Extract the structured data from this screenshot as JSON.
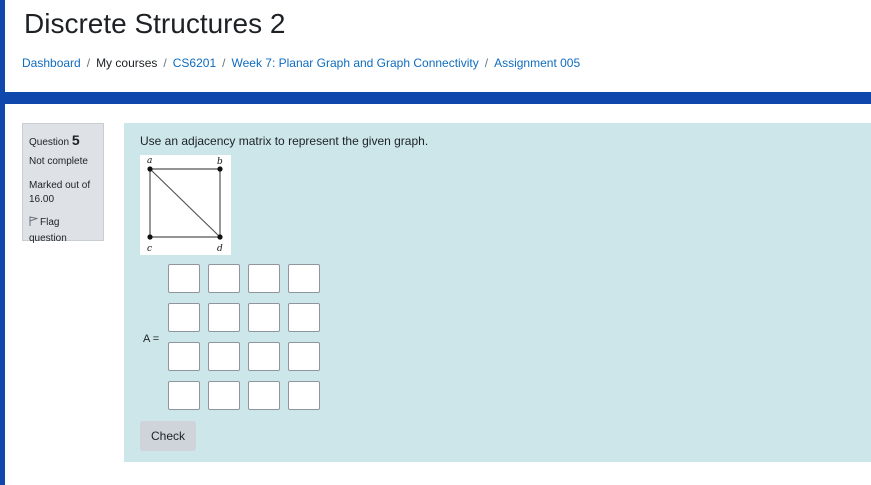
{
  "course": {
    "title": "Discrete Structures 2"
  },
  "breadcrumb": [
    {
      "label": "Dashboard",
      "link": true
    },
    {
      "label": "My courses",
      "link": false
    },
    {
      "label": "CS6201",
      "link": true
    },
    {
      "label": "Week 7: Planar Graph and Graph Connectivity",
      "link": true
    },
    {
      "label": "Assignment 005",
      "link": true
    }
  ],
  "question_info": {
    "question_label": "Question",
    "number": "5",
    "state": "Not complete",
    "grade_line1": "Marked out of",
    "grade_value": "16.00",
    "flag_line1": "Flag",
    "flag_line2": "question"
  },
  "question": {
    "text": "Use an adjacency matrix to represent the given graph.",
    "graph": {
      "vertices": [
        "a",
        "b",
        "c",
        "d"
      ],
      "edges": [
        [
          "a",
          "b"
        ],
        [
          "a",
          "c"
        ],
        [
          "a",
          "d"
        ],
        [
          "b",
          "d"
        ],
        [
          "c",
          "d"
        ]
      ]
    },
    "matrix_label": "A =",
    "matrix": {
      "rows": 4,
      "cols": 4,
      "values": [
        [
          "",
          "",
          "",
          ""
        ],
        [
          "",
          "",
          "",
          ""
        ],
        [
          "",
          "",
          "",
          ""
        ],
        [
          "",
          "",
          "",
          ""
        ]
      ]
    },
    "check_label": "Check"
  },
  "colors": {
    "brand_blue": "#0f47ad",
    "link": "#0f6cbf",
    "content_bg": "#cce6ea",
    "info_bg": "#dee2e6"
  }
}
